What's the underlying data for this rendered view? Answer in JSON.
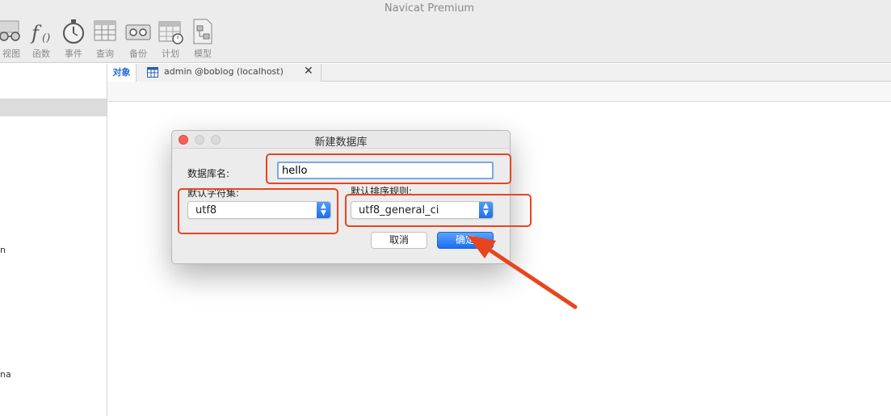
{
  "app": {
    "title": "Navicat Premium"
  },
  "toolbar": {
    "items": [
      {
        "label": "视图",
        "icon": "glasses-view-icon"
      },
      {
        "label": "函数",
        "icon": "function-fx-icon"
      },
      {
        "label": "事件",
        "icon": "stopwatch-icon"
      },
      {
        "label": "查询",
        "icon": "query-table-icon"
      },
      {
        "label": "备份",
        "icon": "backup-tape-icon"
      },
      {
        "label": "计划",
        "icon": "calendar-schedule-icon"
      },
      {
        "label": "模型",
        "icon": "model-diagram-icon"
      }
    ]
  },
  "sidebar": {
    "fragments": [
      "n",
      "na"
    ]
  },
  "tabs": {
    "objects_label": "对象",
    "table_tab_label": "admin @boblog (localhost)",
    "close_glyph": "✕"
  },
  "dialog": {
    "title": "新建数据库",
    "db_name_label": "数据库名:",
    "db_name_value": "hello",
    "charset_label": "默认字符集:",
    "charset_value": "utf8",
    "collation_label": "默认排序规则:",
    "collation_value": "utf8_general_ci",
    "cancel_label": "取消",
    "ok_label": "确定"
  },
  "annotation": {
    "color": "#e8451f"
  }
}
